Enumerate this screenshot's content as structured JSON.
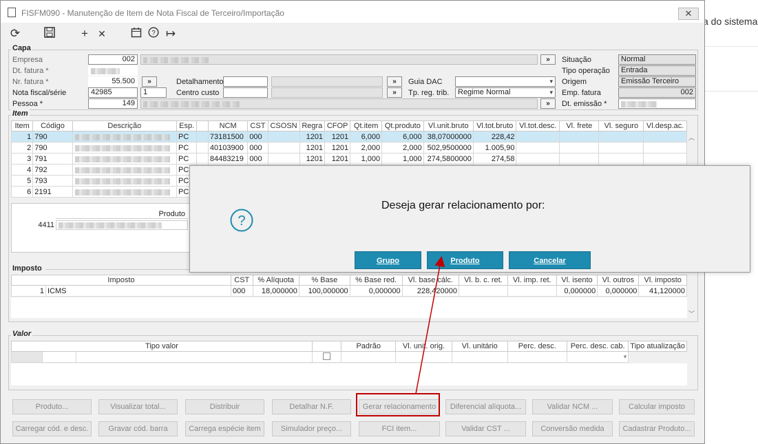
{
  "window": {
    "title": "FISFM090 - Manutenção de Item de Nota Fiscal de Terceiro/Importação",
    "close": "✕"
  },
  "background_text": "a do sistema",
  "toolbar": {
    "refresh": "⟳",
    "save": "💾",
    "add": "+",
    "delete": "✕",
    "calendar": "📅",
    "help": "?",
    "exit": "↦"
  },
  "capa": {
    "title": "Capa",
    "empresa_label": "Empresa",
    "empresa": "002",
    "dt_fatura_label": "Dt. fatura *",
    "nr_fatura_label": "Nr. fatura *",
    "nr_fatura": "55.500",
    "nota_label": "Nota fiscal/série",
    "nota": "42985",
    "serie": "1",
    "pessoa_label": "Pessoa *",
    "pessoa": "149",
    "detalhamento_label": "Detalhamento",
    "centro_custo_label": "Centro custo",
    "guia_dac_label": "Guia DAC",
    "tp_reg_label": "Tp. reg. trib.",
    "tp_reg": "Regime Normal",
    "situacao_label": "Situação",
    "situacao": "Normal",
    "tipo_op_label": "Tipo operação",
    "tipo_op": "Entrada",
    "origem_label": "Origem",
    "origem": "Emissão Terceiro",
    "emp_fatura_label": "Emp. fatura",
    "emp_fatura": "002",
    "dt_emissao_label": "Dt. emissão *"
  },
  "item": {
    "title": "Item",
    "columns": [
      "Item",
      "Código",
      "Descrição",
      "Esp.",
      "",
      "NCM",
      "CST",
      "CSOSN",
      "Regra",
      "CFOP",
      "Qt.item",
      "Qt.produto",
      "Vl.unit.bruto",
      "Vl.tot.bruto",
      "Vl.tot.desc.",
      "Vl. frete",
      "Vl. seguro",
      "Vl.desp.ac."
    ],
    "rows": [
      [
        "1",
        "790",
        "",
        "PC",
        "",
        "73181500",
        "000",
        "",
        "1201",
        "1201",
        "6,000",
        "6,000",
        "38,07000000",
        "228,42",
        "",
        "",
        "",
        ""
      ],
      [
        "2",
        "790",
        "",
        "PC",
        "",
        "40103900",
        "000",
        "",
        "1201",
        "1201",
        "2,000",
        "2,000",
        "502,9500000",
        "1.005,90",
        "",
        "",
        "",
        ""
      ],
      [
        "3",
        "791",
        "",
        "PC",
        "",
        "84483219",
        "000",
        "",
        "1201",
        "1201",
        "1,000",
        "1,000",
        "274,5800000",
        "274,58",
        "",
        "",
        "",
        ""
      ],
      [
        "4",
        "792",
        "",
        "PC",
        "",
        "",
        "",
        "",
        "",
        "",
        "",
        "",
        "",
        "",
        "",
        "",
        "",
        ""
      ],
      [
        "5",
        "793",
        "",
        "PC",
        "",
        "",
        "",
        "",
        "",
        "",
        "",
        "",
        "",
        "",
        "",
        "",
        "",
        ""
      ],
      [
        "6",
        "2191",
        "",
        "PC",
        "",
        "",
        "",
        "",
        "",
        "",
        "",
        "",
        "",
        "",
        "",
        "",
        "",
        ""
      ]
    ]
  },
  "produto": {
    "header": "Produto",
    "code": "4411"
  },
  "imposto": {
    "title": "Imposto",
    "columns": [
      "Imposto",
      "CST",
      "% Alíquota",
      "% Base",
      "% Base red.",
      "Vl. base cálc.",
      "Vl. b. c. ret.",
      "Vl. imp. ret.",
      "Vl. isento",
      "Vl. outros",
      "Vl. imposto"
    ],
    "row": [
      "1",
      "ICMS",
      "000",
      "18,000000",
      "100,000000",
      "0,000000",
      "228,420000",
      "",
      "",
      "0,000000",
      "0,000000",
      "41,120000"
    ]
  },
  "valor": {
    "title": "Valor",
    "columns": [
      "Tipo valor",
      "",
      "Padrão",
      "Vl. unit. orig.",
      "Vl. unitário",
      "Perc. desc.",
      "Perc. desc. cab.",
      "Tipo atualização"
    ]
  },
  "buttons_row1": [
    "Produto...",
    "Visualizar total...",
    "Distribuir",
    "Detalhar N.F.",
    "Gerar relacionamento",
    "Diferencial alíquota...",
    "Validar NCM ...",
    "Calcular imposto"
  ],
  "buttons_row2": [
    "Carregar cód. e desc.",
    "Gravar cód. barra",
    "Carrega espécie item",
    "Simulador preço...",
    "FCI item...",
    "Validar CST ...",
    "Conversão medida",
    "Cadastrar Produto..."
  ],
  "dialog": {
    "message": "Deseja gerar relacionamento por:",
    "btn_grupo": "Grupo",
    "btn_produto": "Produto",
    "btn_cancelar": "Cancelar",
    "icon": "question-icon",
    "accent": "#1e8bb0",
    "annotation_color": "#c00000"
  }
}
